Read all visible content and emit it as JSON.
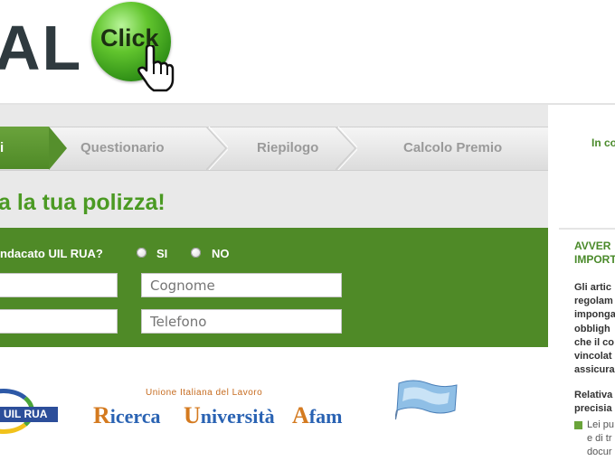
{
  "header": {
    "logo_text": "AL",
    "logo_ball_text": "Click"
  },
  "steps": {
    "active_label": "i",
    "items": [
      "Questionario",
      "Riepilogo",
      "Calcolo Premio"
    ]
  },
  "headline": "a la tua polizza!",
  "form": {
    "question": "ndacato UIL RUA?",
    "options": [
      "SI",
      "NO"
    ],
    "placeholders": {
      "cognome": "Cognome",
      "telefono": "Telefono",
      "left1": "",
      "left2": ""
    }
  },
  "logos": {
    "uil_badge": "UIL RUA",
    "union_line": "Unione Italiana del Lavoro",
    "union_words": [
      {
        "first": "R",
        "rest": "icerca"
      },
      {
        "first": "U",
        "rest": "niversità"
      },
      {
        "first": "A",
        "rest": "fam"
      }
    ]
  },
  "sidebar": {
    "top_text": "In co",
    "title_lines": [
      "AVVER",
      "IMPORT"
    ],
    "body_lines": [
      "Gli artic",
      "regolam",
      "imponga",
      "obbligh",
      "che il co",
      "vincolat",
      "assicura"
    ],
    "sub_lines": [
      "Relativa",
      "precisia"
    ],
    "bullet_lines": [
      "Lei pu",
      "e di tr",
      "docur"
    ]
  },
  "colors": {
    "brand_green": "#4f8a27",
    "headline_green": "#4b9a23",
    "tab_text": "#9a9a9a"
  }
}
